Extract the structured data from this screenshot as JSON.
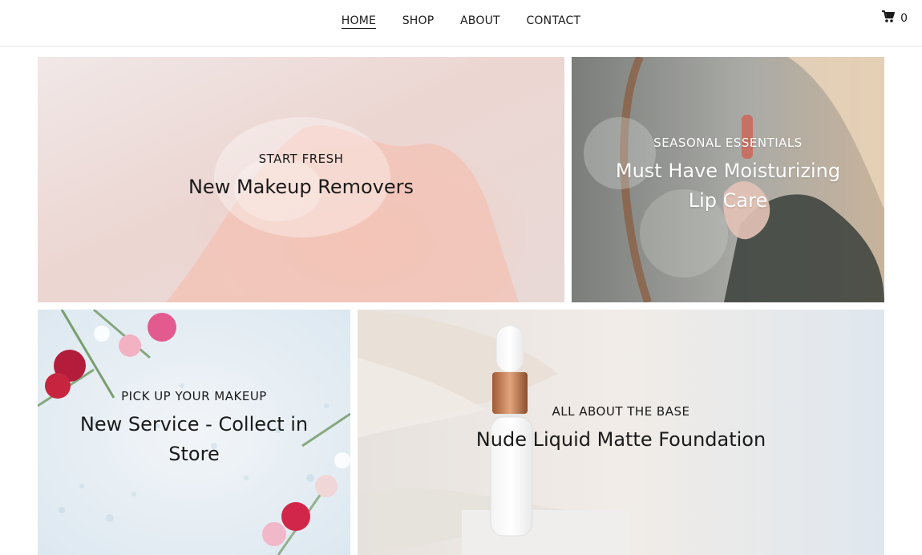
{
  "header": {
    "nav": [
      {
        "label": "HOME"
      },
      {
        "label": "SHOP"
      },
      {
        "label": "ABOUT"
      },
      {
        "label": "CONTACT"
      }
    ],
    "cart_count": "0"
  },
  "tiles": [
    {
      "kicker": "START FRESH",
      "headline": "New Makeup Removers"
    },
    {
      "kicker": "SEASONAL ESSENTIALS",
      "headline": "Must Have Moisturizing Lip Care"
    },
    {
      "kicker": "PICK UP YOUR MAKEUP",
      "headline": "New Service - Collect in Store"
    },
    {
      "kicker": "ALL ABOUT THE BASE",
      "headline": "Nude Liquid Matte Foundation"
    }
  ],
  "colors": {
    "text": "#1a1a1a",
    "header_border": "#e7e7e7"
  }
}
